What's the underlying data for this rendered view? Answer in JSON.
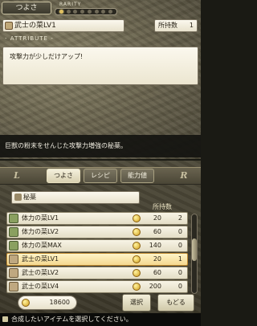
{
  "top": {
    "tab_label": "つよさ",
    "rarity_label": "RARITY",
    "rarity": {
      "filled": 1,
      "total": 8
    },
    "item_name": "武士の菜LV1",
    "owned_label": "所持数",
    "owned_value": "1",
    "attribute_label": "- ATTRIBUTE -",
    "attribute_text": "攻撃力が少しだけアップ!",
    "description": "巨獣の粉末をせんじた攻撃力増強の秘薬。"
  },
  "bottom": {
    "lr_left": "L",
    "lr_right": "R",
    "tabs": [
      {
        "label": "つよさ",
        "active": true
      },
      {
        "label": "レシピ",
        "active": false
      },
      {
        "label": "能力値",
        "active": false
      }
    ],
    "category": "秘薬",
    "owned_header": "所持数",
    "items": [
      {
        "name": "体力の菜LV1",
        "price": "20",
        "count": "2",
        "icon": "herb-icon",
        "selected": false
      },
      {
        "name": "体力の菜LV2",
        "price": "60",
        "count": "0",
        "icon": "herb-icon",
        "selected": false
      },
      {
        "name": "体力の菜MAX",
        "price": "140",
        "count": "0",
        "icon": "herb-icon",
        "selected": false
      },
      {
        "name": "武士の菜LV1",
        "price": "20",
        "count": "1",
        "icon": "potion-icon",
        "selected": true
      },
      {
        "name": "武士の菜LV2",
        "price": "60",
        "count": "0",
        "icon": "potion-icon",
        "selected": false
      },
      {
        "name": "武士の菜LV4",
        "price": "200",
        "count": "0",
        "icon": "potion-icon",
        "selected": false
      }
    ],
    "money": "18600",
    "select_button": "選択",
    "back_button": "もどる",
    "status_text": "合成したいアイテムを選択してください。"
  }
}
